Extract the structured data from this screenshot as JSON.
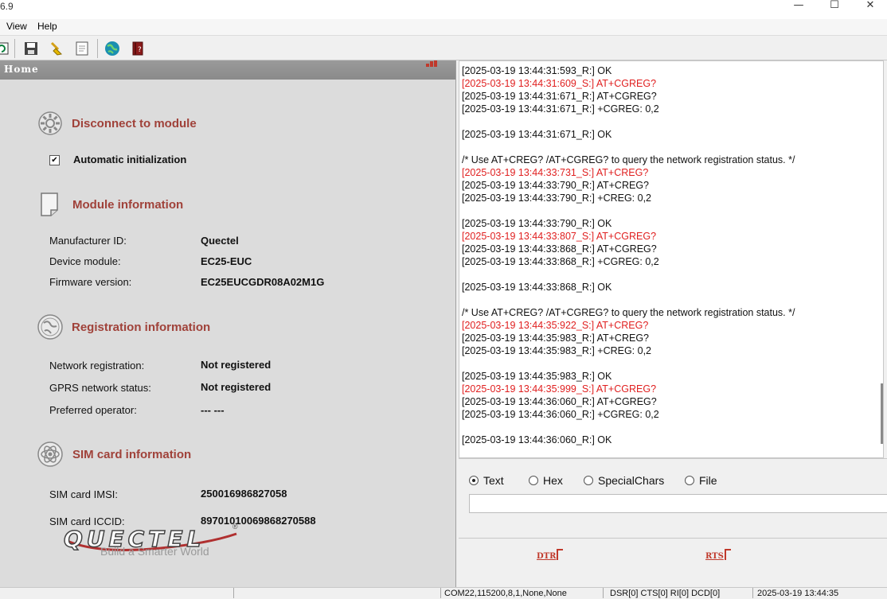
{
  "window": {
    "title_fragment": "6.9",
    "minimize_glyph": "—",
    "maximize_glyph": "☐",
    "close_glyph": "✕"
  },
  "menu": {
    "items": [
      "View",
      "Help"
    ]
  },
  "toolbar": {
    "buttons": [
      "refresh-icon",
      "save-icon",
      "clear-icon",
      "file-icon",
      "globe-icon",
      "book-icon"
    ]
  },
  "home": {
    "label": "Home",
    "signal_bars": 3
  },
  "connection": {
    "title": "Disconnect to module",
    "auto_init_label": "Automatic initialization",
    "auto_init_checked": true
  },
  "module": {
    "title": "Module information",
    "manufacturer_label": "Manufacturer ID:",
    "manufacturer": "Quectel",
    "device_label": "Device module:",
    "device": "EC25-EUC",
    "firmware_label": "Firmware version:",
    "firmware": "EC25EUCGDR08A02M1G"
  },
  "registration": {
    "title": "Registration information",
    "network_label": "Network registration:",
    "network": "Not registered",
    "gprs_label": "GPRS network status:",
    "gprs": "Not registered",
    "operator_label": "Preferred operator:",
    "operator": "--- ---"
  },
  "sim": {
    "title": "SIM card information",
    "imsi_label": "SIM card IMSI:",
    "imsi": "250016986827058",
    "iccid_label": "SIM card ICCID:",
    "iccid": "89701010069868270588"
  },
  "logo": {
    "brand": "QUECTEL",
    "reg": "®",
    "tagline": "Build a Smarter World"
  },
  "log": [
    {
      "t": "R",
      "text": "[2025-03-19 13:44:31:593_R:] OK"
    },
    {
      "t": "S",
      "text": "[2025-03-19 13:44:31:609_S:] AT+CGREG?"
    },
    {
      "t": "R",
      "text": "[2025-03-19 13:44:31:671_R:] AT+CGREG?"
    },
    {
      "t": "R",
      "text": "[2025-03-19 13:44:31:671_R:] +CGREG: 0,2"
    },
    {
      "t": "B",
      "text": ""
    },
    {
      "t": "R",
      "text": "[2025-03-19 13:44:31:671_R:] OK"
    },
    {
      "t": "B",
      "text": ""
    },
    {
      "t": "C",
      "text": "/* Use AT+CREG? /AT+CGREG? to query the network registration status. */"
    },
    {
      "t": "S",
      "text": "[2025-03-19 13:44:33:731_S:] AT+CREG?"
    },
    {
      "t": "R",
      "text": "[2025-03-19 13:44:33:790_R:] AT+CREG?"
    },
    {
      "t": "R",
      "text": "[2025-03-19 13:44:33:790_R:] +CREG: 0,2"
    },
    {
      "t": "B",
      "text": ""
    },
    {
      "t": "R",
      "text": "[2025-03-19 13:44:33:790_R:] OK"
    },
    {
      "t": "S",
      "text": "[2025-03-19 13:44:33:807_S:] AT+CGREG?"
    },
    {
      "t": "R",
      "text": "[2025-03-19 13:44:33:868_R:] AT+CGREG?"
    },
    {
      "t": "R",
      "text": "[2025-03-19 13:44:33:868_R:] +CGREG: 0,2"
    },
    {
      "t": "B",
      "text": ""
    },
    {
      "t": "R",
      "text": "[2025-03-19 13:44:33:868_R:] OK"
    },
    {
      "t": "B",
      "text": ""
    },
    {
      "t": "C",
      "text": "/* Use AT+CREG? /AT+CGREG? to query the network registration status. */"
    },
    {
      "t": "S",
      "text": "[2025-03-19 13:44:35:922_S:] AT+CREG?"
    },
    {
      "t": "R",
      "text": "[2025-03-19 13:44:35:983_R:] AT+CREG?"
    },
    {
      "t": "R",
      "text": "[2025-03-19 13:44:35:983_R:] +CREG: 0,2"
    },
    {
      "t": "B",
      "text": ""
    },
    {
      "t": "R",
      "text": "[2025-03-19 13:44:35:983_R:] OK"
    },
    {
      "t": "S",
      "text": "[2025-03-19 13:44:35:999_S:] AT+CGREG?"
    },
    {
      "t": "R",
      "text": "[2025-03-19 13:44:36:060_R:] AT+CGREG?"
    },
    {
      "t": "R",
      "text": "[2025-03-19 13:44:36:060_R:] +CGREG: 0,2"
    },
    {
      "t": "B",
      "text": ""
    },
    {
      "t": "R",
      "text": "[2025-03-19 13:44:36:060_R:] OK"
    }
  ],
  "send": {
    "modes": [
      {
        "label": "Text",
        "selected": true
      },
      {
        "label": "Hex",
        "selected": false
      },
      {
        "label": "SpecialChars",
        "selected": false
      },
      {
        "label": "File",
        "selected": false
      }
    ],
    "input_value": ""
  },
  "signals": {
    "dtr": "DTR",
    "rts": "RTS"
  },
  "status": {
    "port": "COM22,115200,8,1,None,None",
    "lines": "DSR[0] CTS[0] RI[0] DCD[0]",
    "time": "2025-03-19 13:44:35"
  },
  "colors": {
    "sent": "#e02020",
    "received": "#111111",
    "section_title": "#a0423a"
  }
}
